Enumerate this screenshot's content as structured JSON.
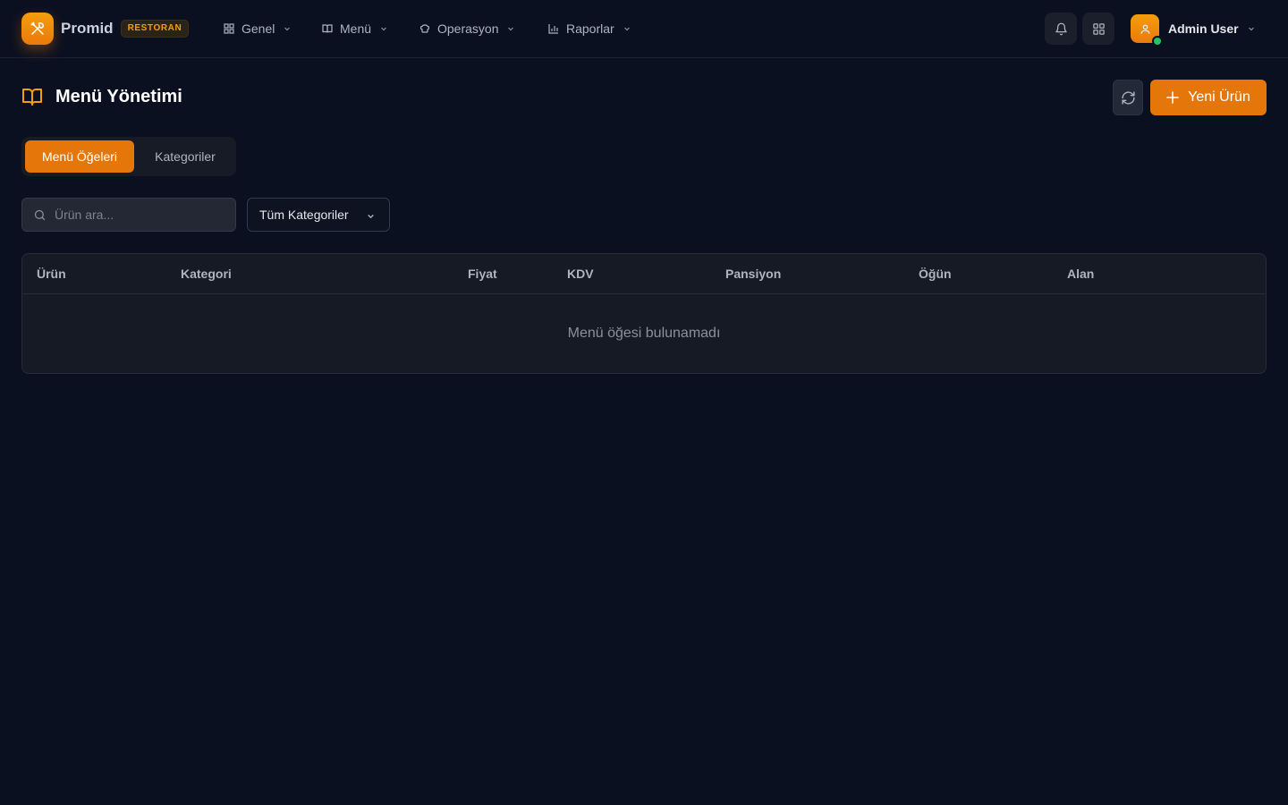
{
  "brand": {
    "name": "Promid",
    "badge": "RESTORAN"
  },
  "nav": {
    "items": [
      {
        "label": "Genel",
        "icon": "grid-icon"
      },
      {
        "label": "Menü",
        "icon": "book-icon"
      },
      {
        "label": "Operasyon",
        "icon": "chef-hat-icon"
      },
      {
        "label": "Raporlar",
        "icon": "bar-chart-icon"
      }
    ]
  },
  "user": {
    "name": "Admin User",
    "status": "online"
  },
  "page": {
    "title": "Menü Yönetimi",
    "new_button_label": "Yeni Ürün"
  },
  "tabs": [
    {
      "label": "Menü Öğeleri",
      "active": true
    },
    {
      "label": "Kategoriler",
      "active": false
    }
  ],
  "filters": {
    "search_placeholder": "Ürün ara...",
    "category_selected": "Tüm Kategoriler"
  },
  "table": {
    "columns": [
      "Ürün",
      "Kategori",
      "Fiyat",
      "KDV",
      "Pansiyon",
      "Öğün",
      "Alan"
    ],
    "empty_message": "Menü öğesi bulunamadı",
    "rows": []
  },
  "colors": {
    "accent": "#e5760a",
    "background": "#0b1020",
    "panel": "#161a24",
    "online": "#22c55e"
  }
}
